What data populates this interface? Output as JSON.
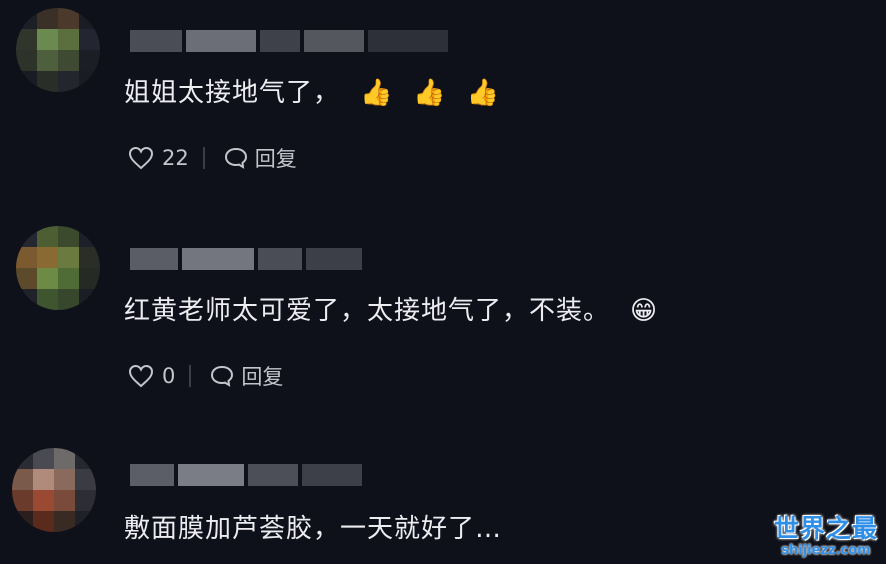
{
  "comments": [
    {
      "text": "姐姐太接地气了，",
      "emojis": [
        "👍",
        "👍",
        "👍"
      ],
      "likes": "22",
      "reply_label": "回复",
      "avatar_colors": [
        "#1d1f27",
        "#3a3027",
        "#4b3a2c",
        "#1b1d25",
        "#30362c",
        "#6a8a4f",
        "#5b6e3e",
        "#232630",
        "#2d3328",
        "#4d5f3c",
        "#3e4a31",
        "#1c1e26",
        "#1a1c24",
        "#2a2e26",
        "#23262c",
        "#1a1c23"
      ],
      "name_colors": [
        "#4a4c56",
        "#6b6d77",
        "#3e404a",
        "#55575f",
        "#2e3039"
      ]
    },
    {
      "text": "红黄老师太可爱了，太接地气了，不装。",
      "emojis": [
        "😁"
      ],
      "likes": "0",
      "reply_label": "回复",
      "avatar_colors": [
        "#242630",
        "#4e5e33",
        "#3b4a2c",
        "#1e2029",
        "#7a5a2e",
        "#8a6a33",
        "#6b7a3e",
        "#2a2e26",
        "#5c4a2a",
        "#6e8b46",
        "#4f6c36",
        "#262a24",
        "#20222a",
        "#3e5530",
        "#36472c",
        "#1c1e26"
      ],
      "name_colors": [
        "#5a5c66",
        "#73757f",
        "#4a4c56",
        "#3c3e48"
      ]
    },
    {
      "text": "敷面膜加芦荟胶，一天就好了…",
      "emojis": [],
      "likes": "",
      "reply_label": "",
      "avatar_colors": [
        "#2a2b33",
        "#4a4a52",
        "#6f6a6a",
        "#26272f",
        "#7a5a4a",
        "#b08a7a",
        "#8a6a5c",
        "#3a3b43",
        "#6a3a2a",
        "#9a4a32",
        "#7a4a3a",
        "#2c2d35",
        "#2a1f1c",
        "#5a2a1c",
        "#3a2a24",
        "#1f2028"
      ],
      "name_colors": [
        "#5b5d67",
        "#7a7c86",
        "#4c4e58",
        "#3d3f49"
      ]
    }
  ],
  "watermark": {
    "title": "世界之最",
    "url": "shijiezz.com"
  }
}
